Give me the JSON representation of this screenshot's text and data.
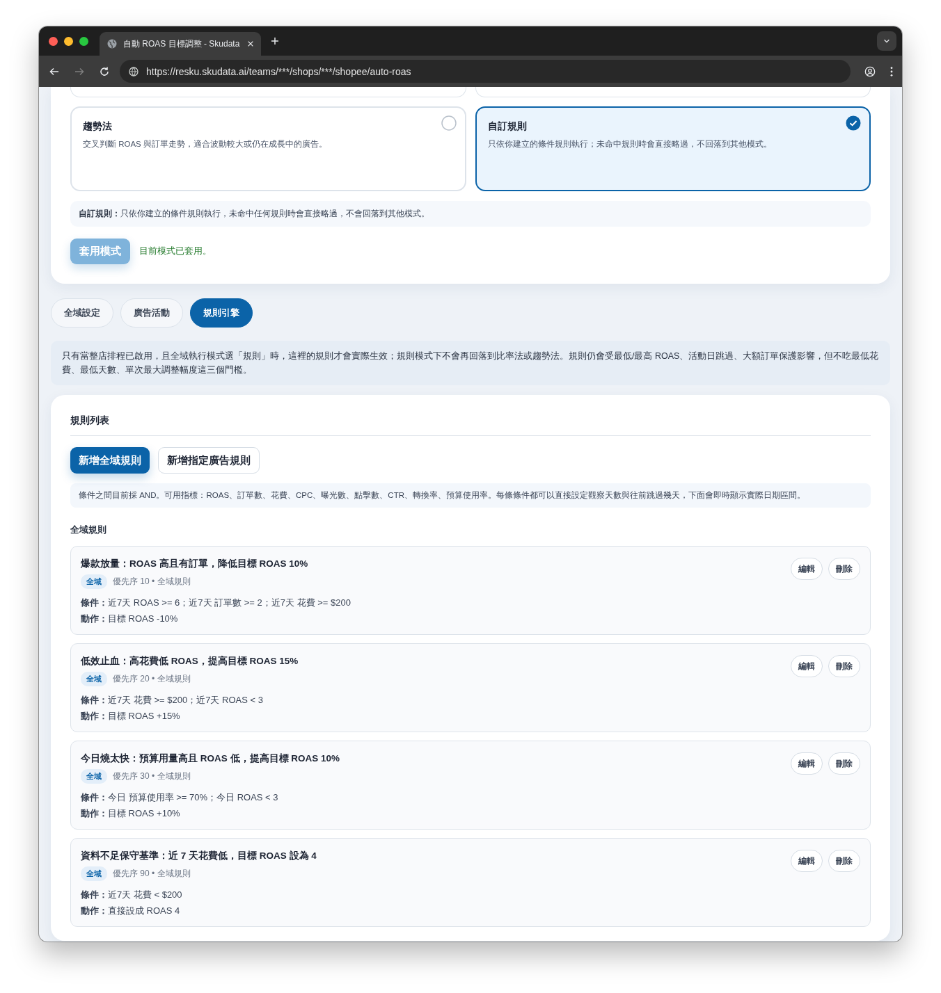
{
  "browser": {
    "tab_title": "自動 ROAS 目標調整 - Skudata",
    "url": "https://resku.skudata.ai/teams/***/shops/***/shopee/auto-roas"
  },
  "mode_cards": [
    {
      "title": "趨勢法",
      "description": "交叉判斷 ROAS 與訂單走勢，適合波動較大或仍在成長中的廣告。",
      "selected": false
    },
    {
      "title": "自訂規則",
      "description": "只依你建立的條件規則執行；未命中規則時會直接略過，不回落到其他模式。",
      "selected": true
    }
  ],
  "mode_note": "**自訂規則：**只依你建立的條件規則執行，未命中任何規則時會直接略過，不會回落到其他模式。",
  "apply_button": {
    "label": "套用模式",
    "disabled": true
  },
  "apply_status": "目前模式已套用。",
  "tabs": [
    {
      "label": "全域設定",
      "selected": false
    },
    {
      "label": "廣告活動",
      "selected": false
    },
    {
      "label": "規則引擎",
      "selected": true
    }
  ],
  "info_text": "只有當整店排程已啟用，且全域執行模式選「規則」時，這裡的規則才會實際生效；規則模式下不會再回落到比率法或趨勢法。規則仍會受最低/最高 ROAS、活動日跳過、大額訂單保護影響，但不吃最低花費、最低天數、單次最大調整幅度這三個門檻。",
  "rules_panel": {
    "title": "規則列表",
    "buttons": [
      {
        "label": "新增全域規則",
        "kind": "primary"
      },
      {
        "label": "新增指定廣告規則",
        "kind": "secondary"
      }
    ],
    "hint": "條件之間目前採 AND。可用指標：ROAS、訂單數、花費、CPC、曝光數、點擊數、CTR、轉換率、預算使用率。每條條件都可以直接設定觀察天數與往前跳過幾天，下面會即時顯示實際日期區間。",
    "section_title": "全域規則",
    "rules": [
      {
        "title": "爆款放量：ROAS 高且有訂單，降低目標 ROAS 10%",
        "tag": "全域",
        "meta": "優先序 10 • 全域規則",
        "conditions": "**條件：**近7天 ROAS >= 6；近7天 訂單數 >= 2；近7天 花費 >= $200",
        "action": "**動作：**目標 ROAS -10%",
        "buttons": [
          "編輯",
          "刪除"
        ]
      },
      {
        "title": "低效止血：高花費低 ROAS，提高目標 ROAS 15%",
        "tag": "全域",
        "meta": "優先序 20 • 全域規則",
        "conditions": "**條件：**近7天 花費 >= $200；近7天 ROAS < 3",
        "action": "**動作：**目標 ROAS +15%",
        "buttons": [
          "編輯",
          "刪除"
        ]
      },
      {
        "title": "今日燒太快：預算用量高且 ROAS 低，提高目標 ROAS 10%",
        "tag": "全域",
        "meta": "優先序 30 • 全域規則",
        "conditions": "**條件：**今日 預算使用率 >= 70%；今日 ROAS < 3",
        "action": "**動作：**目標 ROAS +10%",
        "buttons": [
          "編輯",
          "刪除"
        ]
      },
      {
        "title": "資料不足保守基準：近 7 天花費低，目標 ROAS 設為 4",
        "tag": "全域",
        "meta": "優先序 90 • 全域規則",
        "conditions": "**條件：**近7天 花費 < $200",
        "action": "**動作：**直接設成 ROAS 4",
        "buttons": [
          "編輯",
          "刪除"
        ]
      }
    ]
  }
}
